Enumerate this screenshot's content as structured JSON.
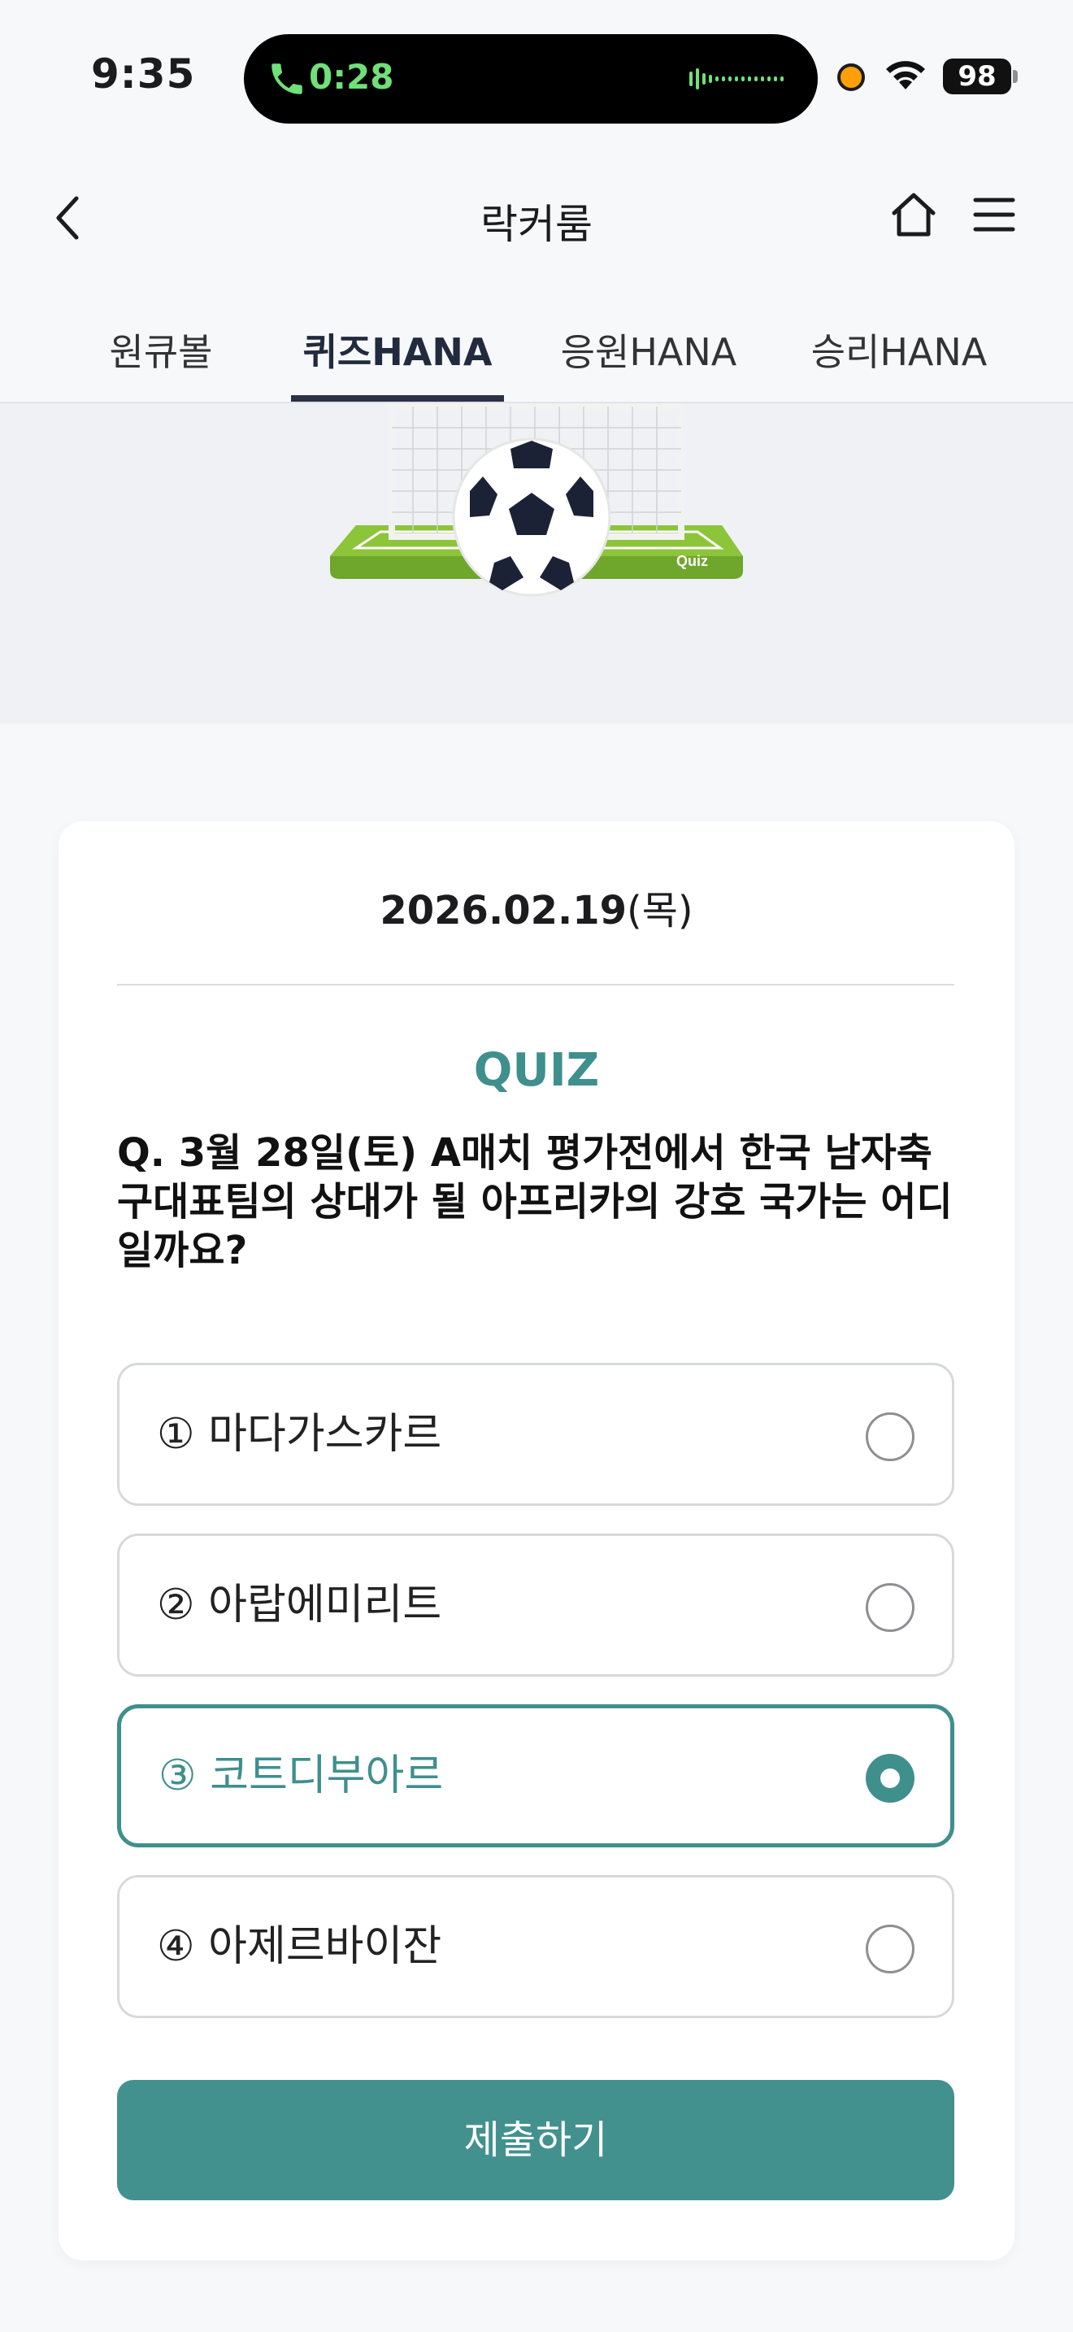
{
  "status_bar": {
    "time": "9:35",
    "call_time": "0:28",
    "battery": "98"
  },
  "header": {
    "title": "락커룸"
  },
  "tabs": [
    {
      "label": "원큐볼"
    },
    {
      "label": "퀴즈HANA",
      "active": true
    },
    {
      "label": "응원HANA"
    },
    {
      "label": "승리HANA"
    }
  ],
  "banner": {
    "badge": "Quiz"
  },
  "quiz": {
    "date": "2026.02.19",
    "weekday": "(목)",
    "label": "QUIZ",
    "question": "Q. 3월 28일(토) A매치 평가전에서 한국 남자축구대표팀의 상대가 될 아프리카의 강호 국가는 어디일까요?",
    "options": [
      {
        "label": "① 마다가스카르",
        "selected": false
      },
      {
        "label": "② 아랍에미리트",
        "selected": false
      },
      {
        "label": "③ 코트디부아르",
        "selected": true
      },
      {
        "label": "④ 아제르바이잔",
        "selected": false
      }
    ],
    "submit_label": "제출하기"
  },
  "colors": {
    "accent": "#3f8f8d",
    "button": "#42918f",
    "tab_active": "#2b3248"
  }
}
